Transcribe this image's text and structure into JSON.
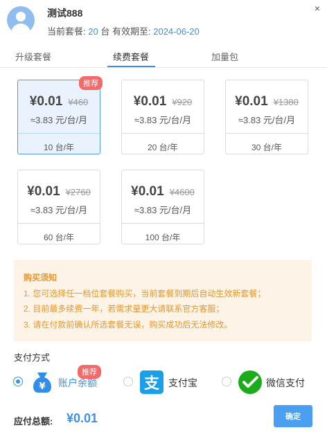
{
  "header": {
    "username": "测试888",
    "plan_label": "当前套餐:",
    "plan_count": "20",
    "plan_unit": "台",
    "expire_label": "有效期至:",
    "expire_date": "2024-06-20",
    "close_symbol": "×"
  },
  "tabs": [
    {
      "label": "升级套餐",
      "active": false
    },
    {
      "label": "续费套餐",
      "active": true
    },
    {
      "label": "加量包",
      "active": false
    }
  ],
  "plans": [
    {
      "price": "¥0.01",
      "original": "¥460",
      "unit_price": "≈3.83 元/台/月",
      "quantity": "10 台/年",
      "badge": "推荐",
      "selected": true
    },
    {
      "price": "¥0.01",
      "original": "¥920",
      "unit_price": "≈3.83 元/台/月",
      "quantity": "20 台/年",
      "selected": false
    },
    {
      "price": "¥0.01",
      "original": "¥1380",
      "unit_price": "≈3.83 元/台/月",
      "quantity": "30 台/年",
      "selected": false
    },
    {
      "price": "¥0.01",
      "original": "¥2760",
      "unit_price": "≈3.83 元/台/月",
      "quantity": "60 台/年",
      "selected": false
    },
    {
      "price": "¥0.01",
      "original": "¥4600",
      "unit_price": "≈3.83 元/台/月",
      "quantity": "100 台/年",
      "selected": false
    }
  ],
  "notice": {
    "title": "购买须知",
    "lines": [
      "1. 您可选择任一档位套餐购买，当前套餐到期后自动生效新套餐；",
      "2. 目前最多续费一年，若需求量更大请联系官方客服；",
      "3. 请在付款前确认所选套餐无误，购买成功后无法修改。"
    ]
  },
  "payment": {
    "label": "支付方式",
    "methods": [
      {
        "label": "账户余额",
        "icon": "wallet-icon",
        "badge": "推荐",
        "checked": true
      },
      {
        "label": "支付宝",
        "icon": "alipay-icon",
        "checked": false
      },
      {
        "label": "微信支付",
        "icon": "wechat-pay-icon",
        "checked": false
      }
    ]
  },
  "total": {
    "label": "应付总额:",
    "value": "¥0.01"
  },
  "confirm_label": "确定",
  "colors": {
    "accent": "#3d8fe5",
    "badge": "#f46a6a",
    "notice_bg": "#fdf4e7",
    "notice_text": "#e8962e",
    "alipay": "#1a9fe8",
    "wechat": "#1aad19"
  }
}
